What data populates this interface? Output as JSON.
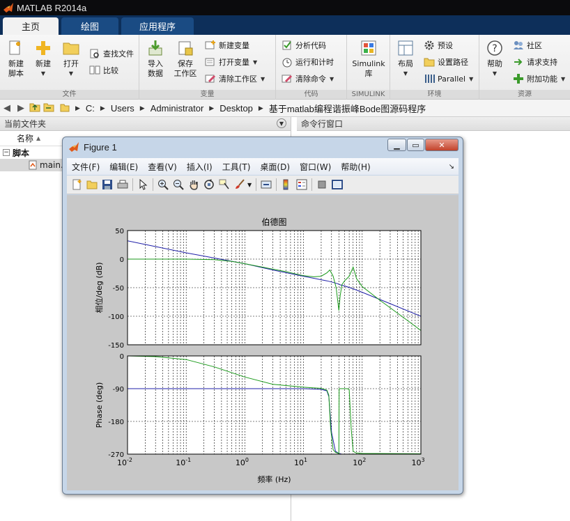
{
  "app": {
    "title": "MATLAB R2014a"
  },
  "tabs": [
    {
      "label": "主页",
      "active": true
    },
    {
      "label": "绘图",
      "active": false
    },
    {
      "label": "应用程序",
      "active": false
    }
  ],
  "ribbon": {
    "file_group": {
      "label": "文件",
      "new_script": "新建\n脚本",
      "new": "新建",
      "open": "打开",
      "find_files": "查找文件",
      "compare": "比较"
    },
    "variable_group": {
      "label": "变量",
      "import": "导入\n数据",
      "save_workspace": "保存\n工作区",
      "new_variable": "新建变量",
      "open_variable": "打开变量",
      "clear_workspace": "清除工作区"
    },
    "code_group": {
      "label": "代码",
      "analyze": "分析代码",
      "run_time": "运行和计时",
      "clear_commands": "清除命令"
    },
    "simulink_group": {
      "label": "SIMULINK",
      "simulink": "Simulink\n库"
    },
    "env_group": {
      "label": "环境",
      "layout": "布局",
      "preferences": "预设",
      "set_path": "设置路径",
      "parallel": "Parallel"
    },
    "resources_group": {
      "label": "资源",
      "help": "帮助",
      "community": "社区",
      "request_support": "请求支持",
      "addons": "附加功能"
    }
  },
  "address": {
    "path": [
      "C:",
      "Users",
      "Administrator",
      "Desktop",
      "基于matlab编程谐振峰Bode图源码程序"
    ]
  },
  "current_folder": {
    "title": "当前文件夹",
    "column_name": "名称",
    "group_label": "脚本",
    "file": "main."
  },
  "command_window": {
    "title": "命令行窗口"
  },
  "figure": {
    "title": "Figure 1",
    "menu": [
      "文件(F)",
      "编辑(E)",
      "查看(V)",
      "插入(I)",
      "工具(T)",
      "桌面(D)",
      "窗口(W)",
      "帮助(H)"
    ],
    "toolbar_icons": [
      "new-figure-icon",
      "open-icon",
      "save-icon",
      "print-icon",
      "pointer-icon",
      "zoom-in-icon",
      "zoom-out-icon",
      "pan-icon",
      "rotate-icon",
      "data-cursor-icon",
      "brush-icon",
      "link-icon",
      "colorbar-icon",
      "legend-icon",
      "hide-plot-tools-icon",
      "show-plot-tools-icon"
    ]
  },
  "chart_data": [
    {
      "type": "line",
      "title": "伯德图",
      "xlabel": "",
      "ylabel": "相位/deg (dB)",
      "xscale": "log",
      "xlim": [
        0.01,
        1000
      ],
      "ylim": [
        -150,
        50
      ],
      "yticks": [
        50,
        0,
        -50,
        -100,
        -150
      ],
      "grid": true,
      "series": [
        {
          "color": "#1f1fa8",
          "x": [
            0.01,
            0.03,
            0.1,
            0.3,
            1,
            3,
            10,
            25,
            30,
            38,
            40,
            42,
            50,
            70,
            100,
            300,
            1000
          ],
          "y": [
            32,
            22,
            11,
            2,
            -8,
            -19,
            -30,
            -38,
            -40,
            -43,
            -44,
            -45,
            -47,
            -52,
            -58,
            -78,
            -100
          ]
        },
        {
          "color": "#1a9a1a",
          "x": [
            0.01,
            0.03,
            0.1,
            0.3,
            0.6,
            1,
            2,
            5,
            10,
            15,
            20,
            25,
            28,
            32,
            36,
            40,
            42,
            45,
            50,
            55,
            60,
            65,
            70,
            75,
            80,
            100,
            200,
            500,
            1000
          ],
          "y": [
            0,
            0,
            0,
            -1,
            -4,
            -8,
            -14,
            -22,
            -29,
            -31,
            -30,
            -24,
            -19,
            -30,
            -50,
            -90,
            -65,
            -45,
            -38,
            -34,
            -30,
            -22,
            -14,
            -24,
            -34,
            -48,
            -72,
            -102,
            -125
          ]
        }
      ]
    },
    {
      "type": "line",
      "title": "",
      "xlabel": "频率 (Hz)",
      "ylabel": "Phase (deg)",
      "xscale": "log",
      "xlim": [
        0.01,
        1000
      ],
      "ylim": [
        -270,
        0
      ],
      "yticks": [
        0,
        -90,
        -180,
        -270
      ],
      "xticks": [
        "10^-2",
        "10^-1",
        "10^0",
        "10^1",
        "10^2",
        "10^3"
      ],
      "grid": true,
      "series": [
        {
          "color": "#1f1fa8",
          "x": [
            0.01,
            0.1,
            1,
            10,
            20,
            25,
            27,
            30,
            35,
            40,
            45,
            60,
            100,
            1000
          ],
          "y": [
            -90,
            -90,
            -90,
            -90,
            -92,
            -96,
            -112,
            -210,
            -262,
            -268,
            -270,
            -270,
            -270,
            -270
          ]
        },
        {
          "color": "#1a9a1a",
          "x": [
            0.01,
            0.03,
            0.1,
            0.3,
            1,
            3,
            10,
            20,
            25,
            27,
            29,
            32,
            35,
            38,
            39,
            40,
            40.5,
            42,
            45,
            55,
            60,
            65,
            70,
            75,
            80,
            100,
            1000
          ],
          "y": [
            0,
            -2,
            -10,
            -30,
            -58,
            -78,
            -86,
            -89,
            -94,
            -108,
            -200,
            -258,
            -265,
            -267,
            -268,
            -268,
            -90,
            -90,
            -90,
            -90,
            -92,
            -200,
            -262,
            -265,
            -267,
            -268,
            -269
          ]
        }
      ]
    }
  ]
}
